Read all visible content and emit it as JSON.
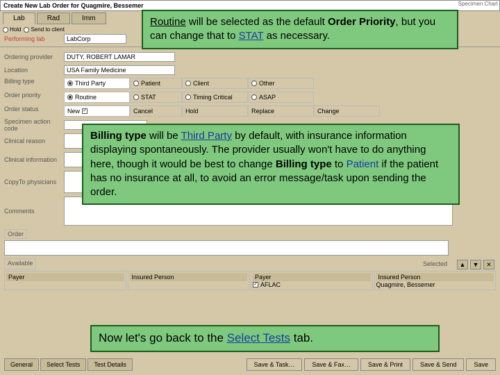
{
  "titlebar": {
    "text": "Create New Lab Order for Quagmire, Bessemer",
    "right": "Specimen Chart"
  },
  "tabs": {
    "lab": "Lab",
    "rad": "Rad",
    "imm": "Imm"
  },
  "segTop": {
    "hold": "Hold",
    "send": "Send to client"
  },
  "performingLab": {
    "label": "Performing lab",
    "value": "LabCorp"
  },
  "fields": {
    "orderingProviderLabel": "Ordering provider",
    "orderingProviderValue": "DUTY, ROBERT LAMAR",
    "locationLabel": "Location",
    "locationValue": "USA Family Medicine",
    "billingTypeLabel": "Billing type",
    "orderPriorityLabel": "Order priority",
    "orderStatusLabel": "Order status",
    "specimenActionLabel": "Specimen action code",
    "clinicalReasonLabel": "Clinical reason",
    "clinicalInfoLabel": "Clinical information",
    "copyToLabel": "CopyTo physicians",
    "commentsLabel": "Comments",
    "orderLabel": "Order",
    "availableLabel": "Available",
    "selectedLabel": "Selected"
  },
  "billingType": {
    "thirdParty": "Third Party",
    "patient": "Patient",
    "client": "Client",
    "other": "Other"
  },
  "orderPriority": {
    "routine": "Routine",
    "stat": "STAT",
    "timingCritical": "Timing Critical",
    "asap": "ASAP"
  },
  "orderStatus": {
    "new": "New",
    "cancel": "Cancel",
    "hold": "Hold",
    "replace": "Replace",
    "change": "Change"
  },
  "colsBottom": {
    "payer": "Payer",
    "insuredPerson": "Insured Person",
    "payer2": "Payer",
    "aflac": "AFLAC",
    "insuredPerson2": "Insured Person",
    "quagmire": "Quagmire, Bessemer"
  },
  "bottomTabs": {
    "general": "General",
    "selectTests": "Select Tests",
    "testDetails": "Test Details"
  },
  "bottomButtons": {
    "saveTask": "Save & Task…",
    "saveFax": "Save & Fax…",
    "savePrint": "Save & Print",
    "saveSend": "Save & Send",
    "save": "Save"
  },
  "callouts": {
    "c1_routine": "Routine",
    "c1_mid1": " will be selected as the default ",
    "c1_orderPriority": "Order Priority",
    "c1_mid2": ", but you can change that to ",
    "c1_stat": "STAT",
    "c1_end": " as necessary.",
    "c2_billing": "Billing type",
    "c2_mid1": " will be ",
    "c2_third": "Third Party",
    "c2_mid2": " by default, with insurance information displaying spontaneously. The provider usually won't have to do anything here, though it would be best to change ",
    "c2_billing2": "Billing type",
    "c2_mid3": " to ",
    "c2_patient": "Patient",
    "c2_end": " if the patient has no insurance at all, to avoid an error message/task upon sending the order.",
    "c3_start": "Now let's go back to the ",
    "c3_select": "Select Tests",
    "c3_end": " tab."
  },
  "icons": {
    "up": "▲",
    "down": "▼",
    "x": "✕"
  }
}
